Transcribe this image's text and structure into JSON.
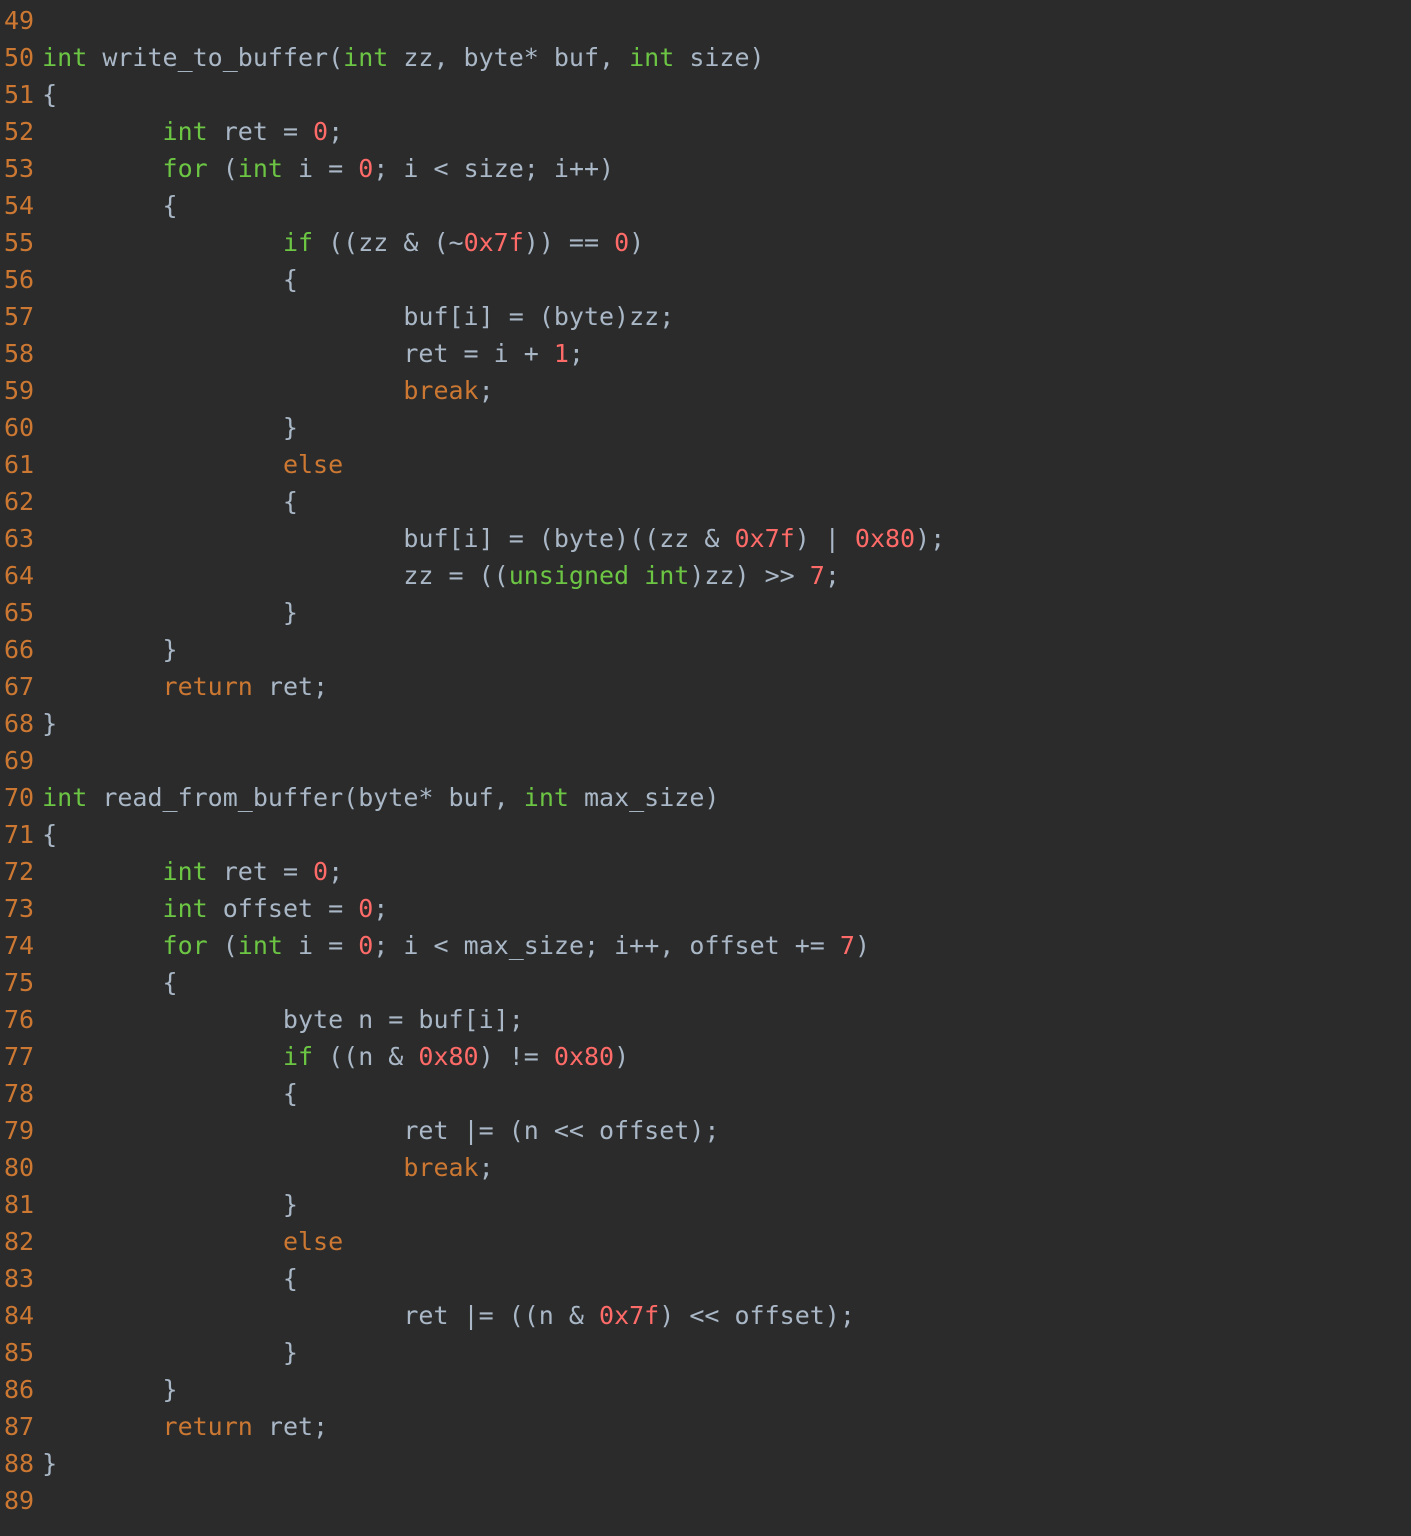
{
  "colors": {
    "background": "#2b2b2b",
    "foreground": "#a9b7c6",
    "lineNumber": "#cc7832",
    "keyword": "#6cc644",
    "number": "#ff6b68",
    "control": "#cc7832"
  },
  "firstLineNumber": 49,
  "lines": [
    {
      "n": 49,
      "spans": [
        {
          "t": "",
          "c": "id"
        }
      ]
    },
    {
      "n": 50,
      "spans": [
        {
          "t": "int",
          "c": "kw"
        },
        {
          "t": " write_to_buffer(",
          "c": "id"
        },
        {
          "t": "int",
          "c": "kw"
        },
        {
          "t": " zz, byte* buf, ",
          "c": "id"
        },
        {
          "t": "int",
          "c": "kw"
        },
        {
          "t": " size)",
          "c": "id"
        }
      ]
    },
    {
      "n": 51,
      "spans": [
        {
          "t": "{",
          "c": "id"
        }
      ]
    },
    {
      "n": 52,
      "spans": [
        {
          "t": "        ",
          "c": "id"
        },
        {
          "t": "int",
          "c": "kw"
        },
        {
          "t": " ret = ",
          "c": "id"
        },
        {
          "t": "0",
          "c": "num"
        },
        {
          "t": ";",
          "c": "id"
        }
      ]
    },
    {
      "n": 53,
      "spans": [
        {
          "t": "        ",
          "c": "id"
        },
        {
          "t": "for",
          "c": "kw"
        },
        {
          "t": " (",
          "c": "id"
        },
        {
          "t": "int",
          "c": "kw"
        },
        {
          "t": " i = ",
          "c": "id"
        },
        {
          "t": "0",
          "c": "num"
        },
        {
          "t": "; i < size; i++)",
          "c": "id"
        }
      ]
    },
    {
      "n": 54,
      "spans": [
        {
          "t": "        {",
          "c": "id"
        }
      ]
    },
    {
      "n": 55,
      "spans": [
        {
          "t": "                ",
          "c": "id"
        },
        {
          "t": "if",
          "c": "kw"
        },
        {
          "t": " ((zz & (~",
          "c": "id"
        },
        {
          "t": "0x7f",
          "c": "num"
        },
        {
          "t": ")) == ",
          "c": "id"
        },
        {
          "t": "0",
          "c": "num"
        },
        {
          "t": ")",
          "c": "id"
        }
      ]
    },
    {
      "n": 56,
      "spans": [
        {
          "t": "                {",
          "c": "id"
        }
      ]
    },
    {
      "n": 57,
      "spans": [
        {
          "t": "                        buf[i] = (byte)zz;",
          "c": "id"
        }
      ]
    },
    {
      "n": 58,
      "spans": [
        {
          "t": "                        ret = i + ",
          "c": "id"
        },
        {
          "t": "1",
          "c": "num"
        },
        {
          "t": ";",
          "c": "id"
        }
      ]
    },
    {
      "n": 59,
      "spans": [
        {
          "t": "                        ",
          "c": "id"
        },
        {
          "t": "break",
          "c": "ctrl"
        },
        {
          "t": ";",
          "c": "id"
        }
      ]
    },
    {
      "n": 60,
      "spans": [
        {
          "t": "                }",
          "c": "id"
        }
      ]
    },
    {
      "n": 61,
      "spans": [
        {
          "t": "                ",
          "c": "id"
        },
        {
          "t": "else",
          "c": "ctrl"
        }
      ]
    },
    {
      "n": 62,
      "spans": [
        {
          "t": "                {",
          "c": "id"
        }
      ]
    },
    {
      "n": 63,
      "spans": [
        {
          "t": "                        buf[i] = (byte)((zz & ",
          "c": "id"
        },
        {
          "t": "0x7f",
          "c": "num"
        },
        {
          "t": ") | ",
          "c": "id"
        },
        {
          "t": "0x80",
          "c": "num"
        },
        {
          "t": ");",
          "c": "id"
        }
      ]
    },
    {
      "n": 64,
      "spans": [
        {
          "t": "                        zz = ((",
          "c": "id"
        },
        {
          "t": "unsigned",
          "c": "kw"
        },
        {
          "t": " ",
          "c": "id"
        },
        {
          "t": "int",
          "c": "kw"
        },
        {
          "t": ")zz) >> ",
          "c": "id"
        },
        {
          "t": "7",
          "c": "num"
        },
        {
          "t": ";",
          "c": "id"
        }
      ]
    },
    {
      "n": 65,
      "spans": [
        {
          "t": "                }",
          "c": "id"
        }
      ]
    },
    {
      "n": 66,
      "spans": [
        {
          "t": "        }",
          "c": "id"
        }
      ]
    },
    {
      "n": 67,
      "spans": [
        {
          "t": "        ",
          "c": "id"
        },
        {
          "t": "return",
          "c": "ctrl"
        },
        {
          "t": " ret;",
          "c": "id"
        }
      ]
    },
    {
      "n": 68,
      "spans": [
        {
          "t": "}",
          "c": "id"
        }
      ]
    },
    {
      "n": 69,
      "spans": [
        {
          "t": "",
          "c": "id"
        }
      ]
    },
    {
      "n": 70,
      "spans": [
        {
          "t": "int",
          "c": "kw"
        },
        {
          "t": " read_from_buffer(byte* buf, ",
          "c": "id"
        },
        {
          "t": "int",
          "c": "kw"
        },
        {
          "t": " max_size)",
          "c": "id"
        }
      ]
    },
    {
      "n": 71,
      "spans": [
        {
          "t": "{",
          "c": "id"
        }
      ]
    },
    {
      "n": 72,
      "spans": [
        {
          "t": "        ",
          "c": "id"
        },
        {
          "t": "int",
          "c": "kw"
        },
        {
          "t": " ret = ",
          "c": "id"
        },
        {
          "t": "0",
          "c": "num"
        },
        {
          "t": ";",
          "c": "id"
        }
      ]
    },
    {
      "n": 73,
      "spans": [
        {
          "t": "        ",
          "c": "id"
        },
        {
          "t": "int",
          "c": "kw"
        },
        {
          "t": " offset = ",
          "c": "id"
        },
        {
          "t": "0",
          "c": "num"
        },
        {
          "t": ";",
          "c": "id"
        }
      ]
    },
    {
      "n": 74,
      "spans": [
        {
          "t": "        ",
          "c": "id"
        },
        {
          "t": "for",
          "c": "kw"
        },
        {
          "t": " (",
          "c": "id"
        },
        {
          "t": "int",
          "c": "kw"
        },
        {
          "t": " i = ",
          "c": "id"
        },
        {
          "t": "0",
          "c": "num"
        },
        {
          "t": "; i < max_size; i++, offset += ",
          "c": "id"
        },
        {
          "t": "7",
          "c": "num"
        },
        {
          "t": ")",
          "c": "id"
        }
      ]
    },
    {
      "n": 75,
      "spans": [
        {
          "t": "        {",
          "c": "id"
        }
      ]
    },
    {
      "n": 76,
      "spans": [
        {
          "t": "                byte n = buf[i];",
          "c": "id"
        }
      ]
    },
    {
      "n": 77,
      "spans": [
        {
          "t": "                ",
          "c": "id"
        },
        {
          "t": "if",
          "c": "kw"
        },
        {
          "t": " ((n & ",
          "c": "id"
        },
        {
          "t": "0x80",
          "c": "num"
        },
        {
          "t": ") != ",
          "c": "id"
        },
        {
          "t": "0x80",
          "c": "num"
        },
        {
          "t": ")",
          "c": "id"
        }
      ]
    },
    {
      "n": 78,
      "spans": [
        {
          "t": "                {",
          "c": "id"
        }
      ]
    },
    {
      "n": 79,
      "spans": [
        {
          "t": "                        ret |= (n << offset);",
          "c": "id"
        }
      ]
    },
    {
      "n": 80,
      "spans": [
        {
          "t": "                        ",
          "c": "id"
        },
        {
          "t": "break",
          "c": "ctrl"
        },
        {
          "t": ";",
          "c": "id"
        }
      ]
    },
    {
      "n": 81,
      "spans": [
        {
          "t": "                }",
          "c": "id"
        }
      ]
    },
    {
      "n": 82,
      "spans": [
        {
          "t": "                ",
          "c": "id"
        },
        {
          "t": "else",
          "c": "ctrl"
        }
      ]
    },
    {
      "n": 83,
      "spans": [
        {
          "t": "                {",
          "c": "id"
        }
      ]
    },
    {
      "n": 84,
      "spans": [
        {
          "t": "                        ret |= ((n & ",
          "c": "id"
        },
        {
          "t": "0x7f",
          "c": "num"
        },
        {
          "t": ") << offset);",
          "c": "id"
        }
      ]
    },
    {
      "n": 85,
      "spans": [
        {
          "t": "                }",
          "c": "id"
        }
      ]
    },
    {
      "n": 86,
      "spans": [
        {
          "t": "        }",
          "c": "id"
        }
      ]
    },
    {
      "n": 87,
      "spans": [
        {
          "t": "        ",
          "c": "id"
        },
        {
          "t": "return",
          "c": "ctrl"
        },
        {
          "t": " ret;",
          "c": "id"
        }
      ]
    },
    {
      "n": 88,
      "spans": [
        {
          "t": "}",
          "c": "id"
        }
      ]
    },
    {
      "n": 89,
      "spans": [
        {
          "t": "",
          "c": "id"
        }
      ]
    }
  ]
}
